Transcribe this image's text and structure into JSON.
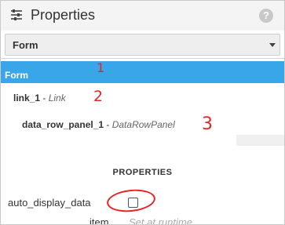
{
  "panel": {
    "title": "Properties",
    "icon": "sliders-icon",
    "help_symbol": "?"
  },
  "component_select": {
    "value": "Form"
  },
  "tree": {
    "items": [
      {
        "name": "Form",
        "type": "",
        "selected": true
      },
      {
        "name": "link_1",
        "sep": " - ",
        "type": "Link",
        "selected": false
      },
      {
        "name": "data_row_panel_1",
        "sep": " - ",
        "type": "DataRowPanel",
        "selected": false
      }
    ]
  },
  "annotations": [
    "1",
    "2",
    "3"
  ],
  "properties": {
    "heading": "PROPERTIES",
    "rows": [
      {
        "label": "auto_display_data",
        "checked": false
      },
      {
        "label": "item",
        "hint": "Set at runtime"
      }
    ]
  },
  "colors": {
    "selection": "#38a6e8",
    "annotation": "#e42525"
  }
}
